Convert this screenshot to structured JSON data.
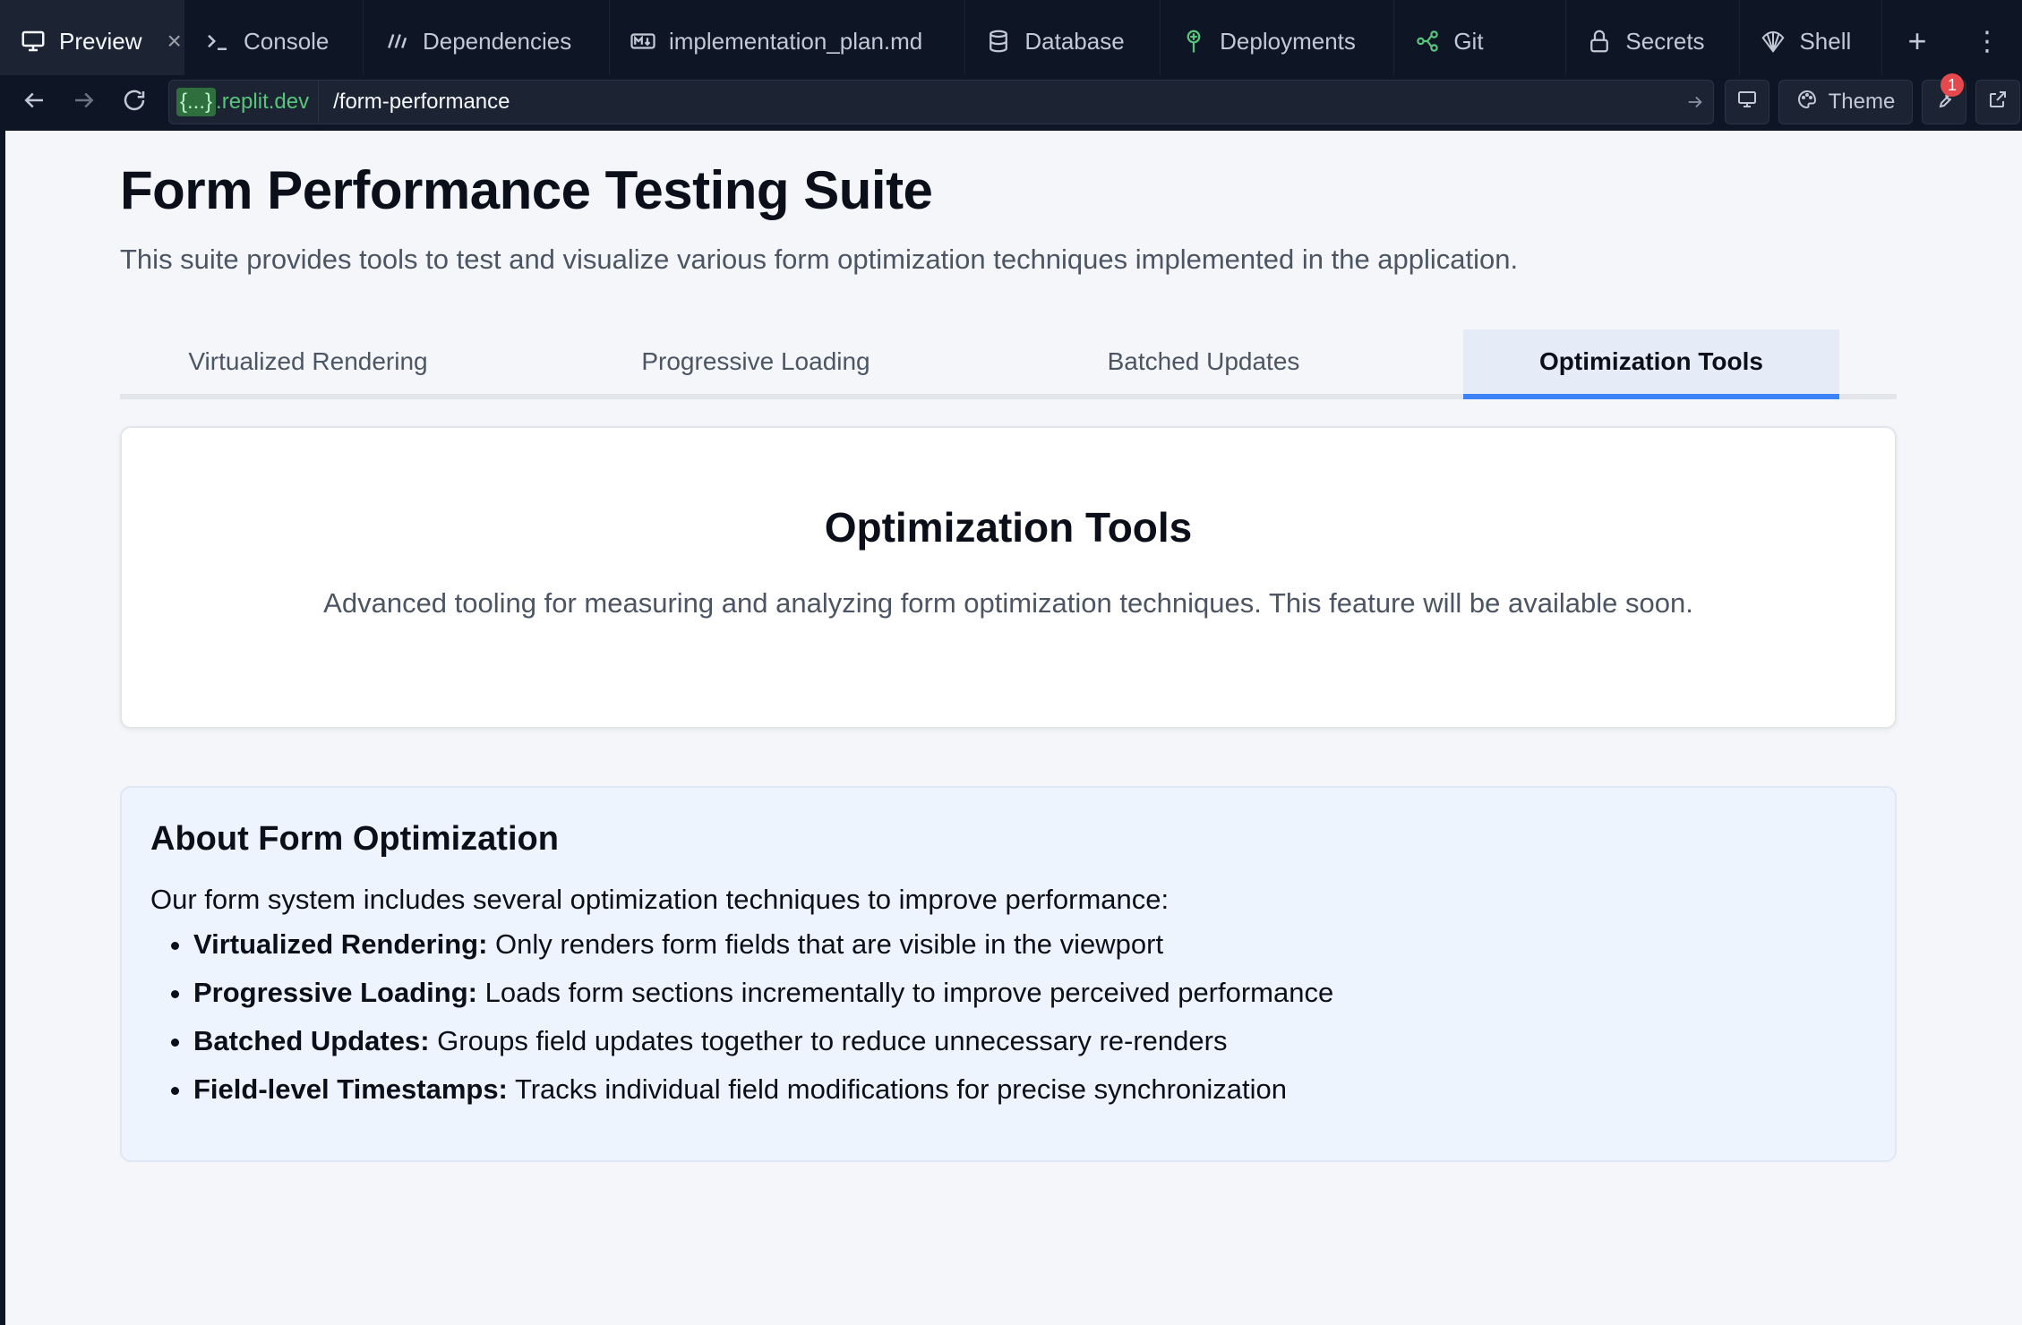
{
  "tabbar": {
    "tabs": [
      {
        "label": "Preview",
        "icon": "monitor-icon",
        "active": true
      },
      {
        "label": "Console",
        "icon": "terminal-icon"
      },
      {
        "label": "Dependencies",
        "icon": "dependencies-icon"
      },
      {
        "label": "implementation_plan.md",
        "icon": "markdown-icon"
      },
      {
        "label": "Database",
        "icon": "database-icon"
      },
      {
        "label": "Deployments",
        "icon": "deployments-icon"
      },
      {
        "label": "Git",
        "icon": "git-icon"
      },
      {
        "label": "Secrets",
        "icon": "lock-icon"
      },
      {
        "label": "Shell",
        "icon": "shell-icon"
      }
    ],
    "close_glyph": "×",
    "add_glyph": "+",
    "more_glyph": "⋮"
  },
  "urlbar": {
    "domain_highlight": "{...}",
    "domain_suffix": ".replit.dev",
    "path": "/form-performance",
    "theme_label": "Theme",
    "badge_count": "1"
  },
  "page": {
    "title": "Form Performance Testing Suite",
    "subtitle": "This suite provides tools to test and visualize various form optimization techniques implemented in the application.",
    "tabs": [
      {
        "label": "Virtualized Rendering"
      },
      {
        "label": "Progressive Loading"
      },
      {
        "label": "Batched Updates"
      },
      {
        "label": "Optimization Tools",
        "active": true
      }
    ],
    "card": {
      "title": "Optimization Tools",
      "text": "Advanced tooling for measuring and analyzing form optimization techniques. This feature will be available soon."
    },
    "info": {
      "title": "About Form Optimization",
      "lead": "Our form system includes several optimization techniques to improve performance:",
      "items": [
        {
          "term": "Virtualized Rendering:",
          "desc": " Only renders form fields that are visible in the viewport"
        },
        {
          "term": "Progressive Loading:",
          "desc": " Loads form sections incrementally to improve perceived performance"
        },
        {
          "term": "Batched Updates:",
          "desc": " Groups field updates together to reduce unnecessary re-renders"
        },
        {
          "term": "Field-level Timestamps:",
          "desc": " Tracks individual field modifications for precise synchronization"
        }
      ]
    }
  },
  "colors": {
    "chrome_bg": "#0e1525",
    "accent_blue": "#3b82f6",
    "domain_green": "#58c67a",
    "badge_red": "#e5484d"
  }
}
